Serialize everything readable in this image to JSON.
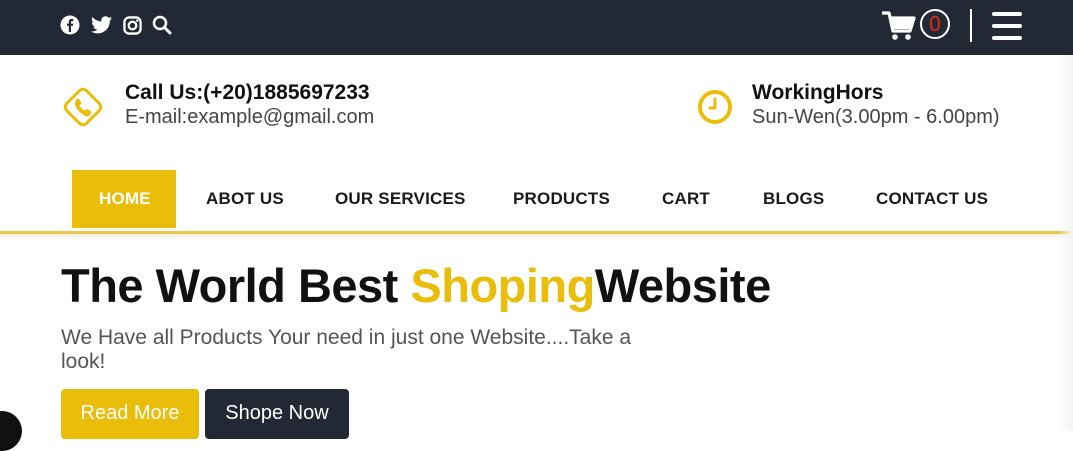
{
  "header": {
    "social_icons": [
      "facebook-icon",
      "twitter-icon",
      "instagram-icon",
      "search-icon"
    ],
    "cart": {
      "count": "0",
      "icon": "cart-icon",
      "count_color": "#e0251b"
    },
    "menu_icon": "hamburger-menu-icon"
  },
  "contact": {
    "phone_label": "Call Us:(+20)1885697233",
    "email_label": "E-mail:example@gmail.com",
    "hours_title": "WorkingHors",
    "hours_text": "Sun-Wen(3.00pm - 6.00pm)"
  },
  "nav": {
    "items": [
      {
        "label": "HOME",
        "active": true
      },
      {
        "label": "ABOT US"
      },
      {
        "label": "OUR SERVICES"
      },
      {
        "label": "PRODUCTS"
      },
      {
        "label": "CART"
      },
      {
        "label": "BLOGS"
      },
      {
        "label": "CONTACT US"
      }
    ]
  },
  "hero": {
    "title_start": "The World Best ",
    "title_accent": "Shoping",
    "title_end": "Website",
    "subtitle": "We Have all Products Your need in just one Website....Take a look!",
    "read_more": "Read More",
    "shop_now": "Shope Now"
  },
  "colors": {
    "accent": "#eabd0a",
    "dark": "#222935"
  }
}
